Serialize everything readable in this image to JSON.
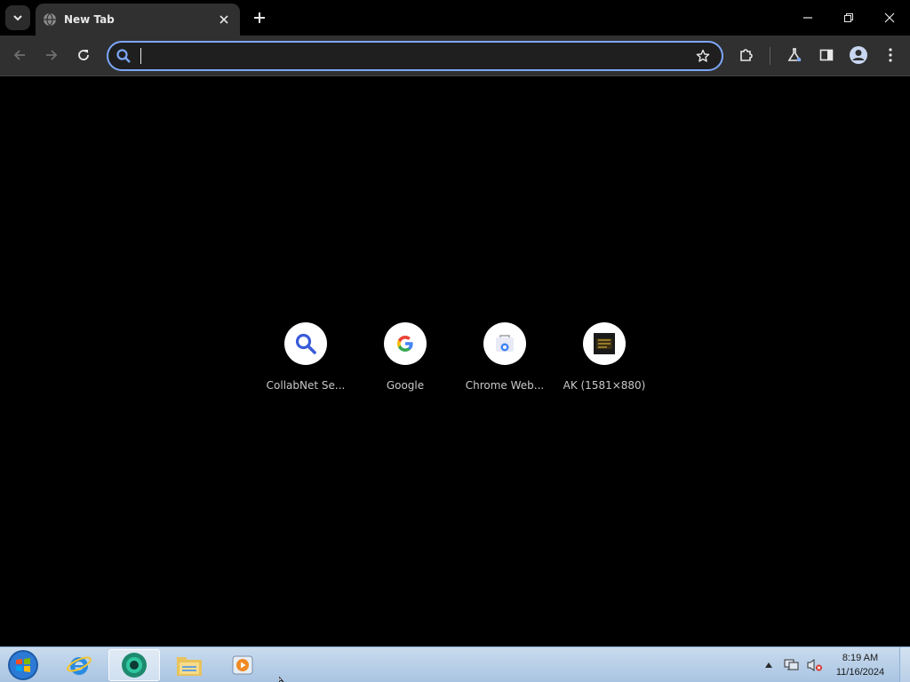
{
  "browser": {
    "tab": {
      "title": "New Tab"
    },
    "omnibox": {
      "value": "",
      "placeholder": ""
    }
  },
  "ntp": {
    "shortcuts": [
      {
        "label": "CollabNet Se...",
        "icon": "magnifier-icon"
      },
      {
        "label": "Google",
        "icon": "google-g-icon"
      },
      {
        "label": "Chrome Web...",
        "icon": "chrome-web-store-icon"
      },
      {
        "label": "AK (1581×880)",
        "icon": "ak-thumbnail-icon"
      }
    ]
  },
  "taskbar": {
    "apps": [
      "start-orb",
      "internet-explorer",
      "chrome-canary",
      "file-explorer",
      "media-player"
    ],
    "clock": {
      "time": "8:19 AM",
      "date": "11/16/2024"
    }
  },
  "colors": {
    "accent": "#7ca7f8",
    "toolbar": "#303030",
    "background": "#000000"
  }
}
